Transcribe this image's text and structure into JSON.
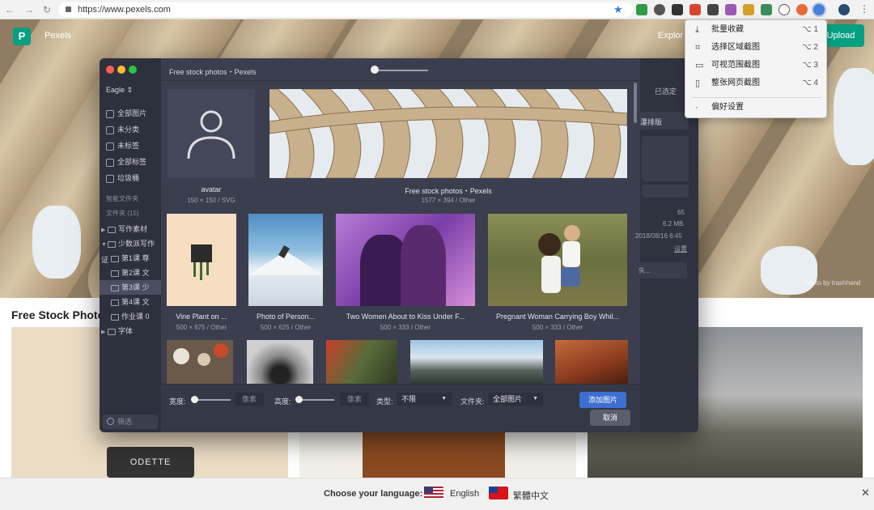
{
  "browser": {
    "url": "https://www.pexels.com"
  },
  "pexels": {
    "logo_letter": "P",
    "site_name": "Pexels",
    "explore": "Explor",
    "upload": "Upload",
    "hero_credit": "Photo by trashhand",
    "section_title": "Free Stock Photos",
    "odette_label": "ODETTE",
    "language_prompt": "Choose your language:",
    "languages": [
      "English",
      "繁體中文"
    ],
    "close": "✕"
  },
  "extension_menu": {
    "items": [
      {
        "label": "批量收藏",
        "shortcut": "⌥ 1",
        "icon": "download-icon"
      },
      {
        "label": "选择区域截图",
        "shortcut": "⌥ 2",
        "icon": "crop-icon"
      },
      {
        "label": "可视范围截图",
        "shortcut": "⌥ 3",
        "icon": "screen-icon"
      },
      {
        "label": "整张网页截图",
        "shortcut": "⌥ 4",
        "icon": "page-icon"
      }
    ],
    "prefs": "偏好设置"
  },
  "eagle": {
    "library": "Eagle ⇕",
    "title": "Free stock photos・Pexels",
    "nav": [
      "全部图片",
      "未分类",
      "未标签",
      "全部标签",
      "垃圾桶"
    ],
    "smart_folders": "智能文件夹",
    "folders_head": "文件夹 (15)",
    "tree": [
      {
        "label": "写作素材",
        "level": 0,
        "tri": "▶"
      },
      {
        "label": "少数派写作证",
        "level": 0,
        "tri": "▼"
      },
      {
        "label": "第1课 尊",
        "level": 1,
        "tri": ""
      },
      {
        "label": "第2课 文",
        "level": 1,
        "tri": ""
      },
      {
        "label": "第3课 少",
        "level": 1,
        "tri": "",
        "selected": true
      },
      {
        "label": "第4课 文",
        "level": 1,
        "tri": ""
      },
      {
        "label": "作业课 0",
        "level": 1,
        "tri": ""
      },
      {
        "label": "字体",
        "level": 0,
        "tri": "▶"
      }
    ],
    "filter_placeholder": "筛选",
    "right": {
      "selected": "已选定",
      "layout": "瀑排版",
      "count": "65",
      "size": "6.2 MB",
      "date": "2018/08/16 6:45",
      "settings": "设置",
      "other": "失..."
    },
    "items": [
      {
        "name": "avatar",
        "meta": "150 × 150 / SVG"
      },
      {
        "name": "Free stock photos・Pexels",
        "meta": "1577 × 394 / Other"
      },
      {
        "name": "Vine Plant on ...",
        "meta": "500 × 675 / Other"
      },
      {
        "name": "Photo of Person...",
        "meta": "500 × 625 / Other"
      },
      {
        "name": "Two Women About to Kiss Under F...",
        "meta": "500 × 333 / Other"
      },
      {
        "name": "Pregnant Woman Carrying Boy Whil...",
        "meta": "500 × 333 / Other"
      }
    ],
    "footer": {
      "width_label": "宽度:",
      "height_label": "高度:",
      "px": "像素",
      "type_label": "类型:",
      "type_value": "不限",
      "folder_label": "文件夹:",
      "folder_value": "全部图片",
      "add": "添加图片",
      "cancel": "取消"
    }
  }
}
